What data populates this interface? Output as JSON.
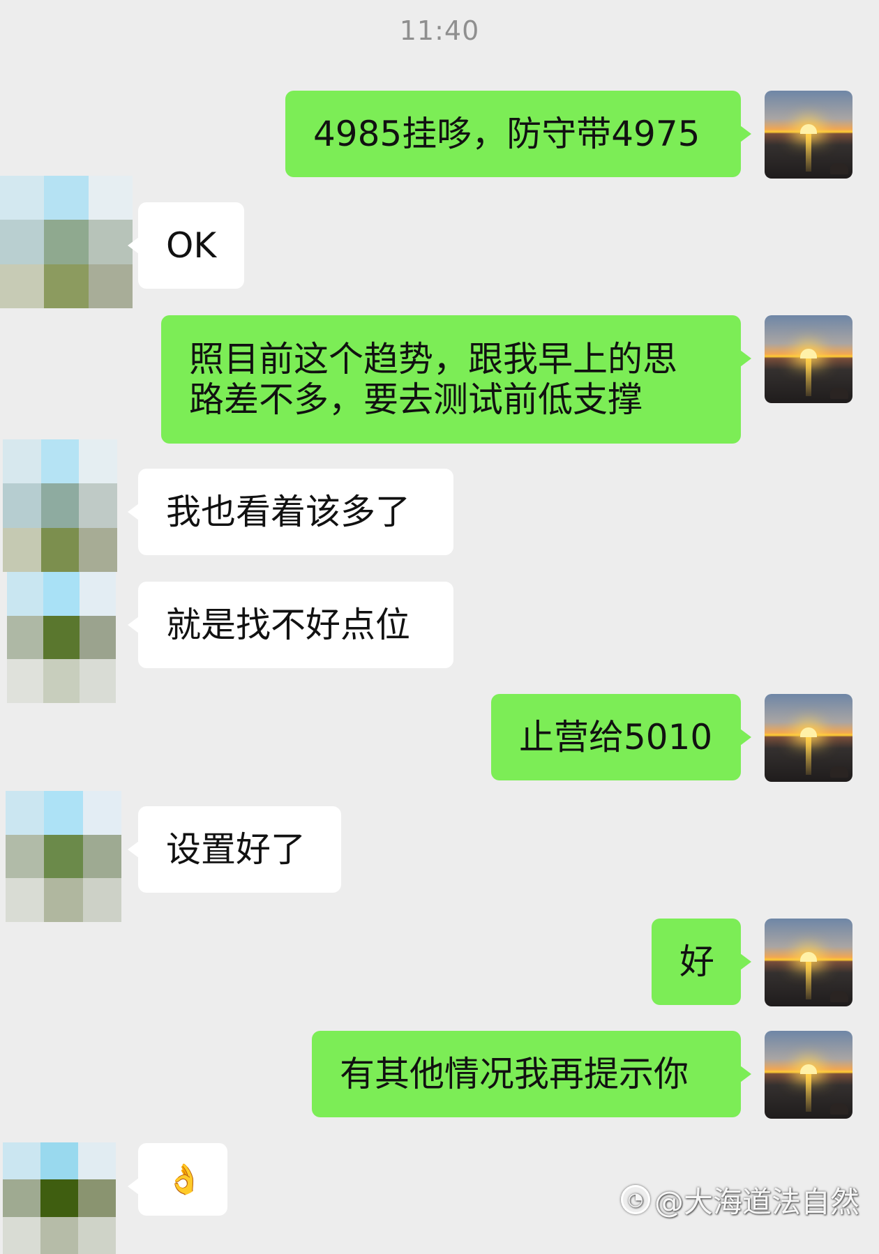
{
  "header": {
    "time": "11:40"
  },
  "messages": [
    {
      "side": "out",
      "text": "4985挂哆，防守带4975"
    },
    {
      "side": "in",
      "text": "OK"
    },
    {
      "side": "out",
      "text": "照目前这个趋势，跟我早上的思\n路差不多，要去测试前低支撑"
    },
    {
      "side": "in",
      "text": "我也看着该多了"
    },
    {
      "side": "in",
      "text": "就是找不好点位"
    },
    {
      "side": "out",
      "text": "止营给5010"
    },
    {
      "side": "in",
      "text": "设置好了"
    },
    {
      "side": "out",
      "text": "好"
    },
    {
      "side": "out",
      "text": "有其他情况我再提示你"
    },
    {
      "side": "in",
      "text": "👌",
      "kind": "emoji"
    }
  ],
  "avatars": {
    "me": {
      "description_icon": "sunset-avatar-icon"
    },
    "contact": {
      "description_icon": "pixelated-avatar-icon"
    }
  },
  "watermark": {
    "text": "@大海道法自然",
    "icon": "weibo-logo-icon"
  },
  "colors": {
    "background": "#ededed",
    "outgoing_bubble": "#7ced56",
    "incoming_bubble": "#ffffff",
    "time_text": "#8f8f8f"
  }
}
